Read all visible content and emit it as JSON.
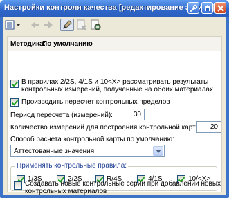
{
  "window": {
    "title": "Настройки контроля качества [редактирование записи]",
    "colors": {
      "titlebar": "#2f66c9",
      "client": "#ece9d8",
      "group_title": "#1e3e94"
    }
  },
  "title_buttons": {
    "icons": [
      "wrench-icon",
      "help-icon",
      "close-icon"
    ]
  },
  "toolbar": {
    "icons": [
      "menu-list-icon",
      "back-arrow-icon",
      "forward-arrow-icon",
      "pencil-icon",
      "cancel-icon",
      "save-icon"
    ]
  },
  "method": {
    "label": "Методика:",
    "value": "По умолчанию"
  },
  "options": {
    "both_materials": {
      "line1": "В правилах 2/2S, 4/1S и 10<X> рассматривать результаты",
      "line2": "контрольных измерений, полученные на обоих материалах",
      "checked": true
    },
    "recalc_limits": {
      "label": "Производить пересчет контрольных пределов",
      "checked": true
    },
    "recalc_period": {
      "label": "Период пересчета (измерений):",
      "value": "30"
    },
    "chart_count": {
      "label": "Количество измерений для построения контрольной карты:",
      "value": "20"
    },
    "calc_method": {
      "label": "Способ расчета контрольной карты по умолчанию:",
      "value": "Аттестованные значения"
    },
    "new_series": {
      "line1": "Создавать новые контрольные серии при добавлении новых",
      "line2": "контрольных материалов",
      "checked": false
    }
  },
  "rules": {
    "title": "Применять контрольные правила:",
    "items": [
      {
        "label": "1/3S",
        "checked": true
      },
      {
        "label": "2/2S",
        "checked": true
      },
      {
        "label": "R/4S",
        "checked": true
      },
      {
        "label": "4/1S",
        "checked": true
      },
      {
        "label": "10/<X>",
        "checked": true
      }
    ]
  }
}
